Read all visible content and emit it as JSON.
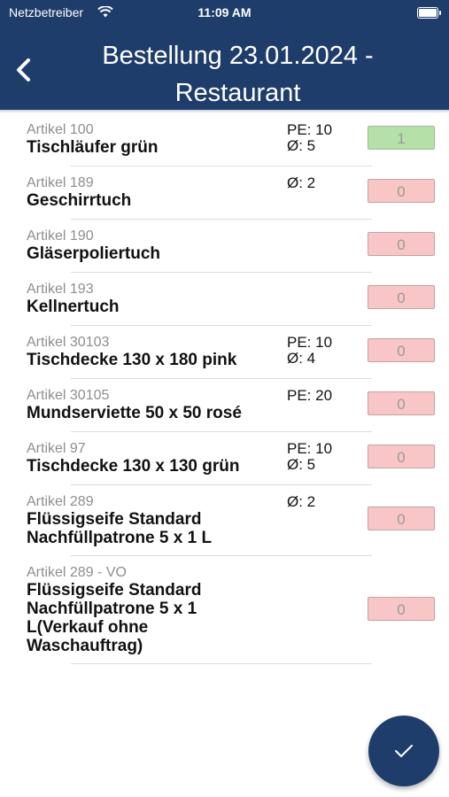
{
  "status_bar": {
    "carrier": "Netzbetreiber",
    "time": "11:09 AM"
  },
  "header": {
    "title": "Bestellung 23.01.2024 - Restaurant",
    "back_icon": "chevron-left-icon"
  },
  "items": [
    {
      "article": "Artikel 100",
      "name": "Tischläufer grün",
      "pe": "PE: 10",
      "avg": "Ø: 5",
      "qty": "1"
    },
    {
      "article": "Artikel 189",
      "name": "Geschirrtuch",
      "pe": "",
      "avg": "Ø: 2",
      "qty": "0"
    },
    {
      "article": "Artikel 190",
      "name": "Gläserpoliertuch",
      "pe": "",
      "avg": "",
      "qty": "0"
    },
    {
      "article": "Artikel 193",
      "name": "Kellnertuch",
      "pe": "",
      "avg": "",
      "qty": "0"
    },
    {
      "article": "Artikel 30103",
      "name": "Tischdecke 130 x 180 pink",
      "pe": "PE: 10",
      "avg": "Ø: 4",
      "qty": "0"
    },
    {
      "article": "Artikel 30105",
      "name": "Mundserviette 50 x 50 rosé",
      "pe": "PE: 20",
      "avg": "",
      "qty": "0"
    },
    {
      "article": "Artikel 97",
      "name": "Tischdecke 130 x 130 grün",
      "pe": "PE: 10",
      "avg": "Ø: 5",
      "qty": "0"
    },
    {
      "article": "Artikel 289",
      "name": "Flüssigseife Standard Nachfüllpatrone 5 x 1 L",
      "pe": "",
      "avg": "Ø: 2",
      "qty": "0"
    },
    {
      "article": "Artikel 289 - VO",
      "name": "Flüssigseife Standard Nachfüllpatrone 5 x 1 L(Verkauf ohne Waschauftrag)",
      "pe": "",
      "avg": "",
      "qty": "0"
    }
  ],
  "fab": {
    "icon": "checkmark-icon"
  },
  "colors": {
    "header": "#1f3d6b",
    "qty_zero": "#f8c6c6",
    "qty_set": "#b5e0a8"
  }
}
